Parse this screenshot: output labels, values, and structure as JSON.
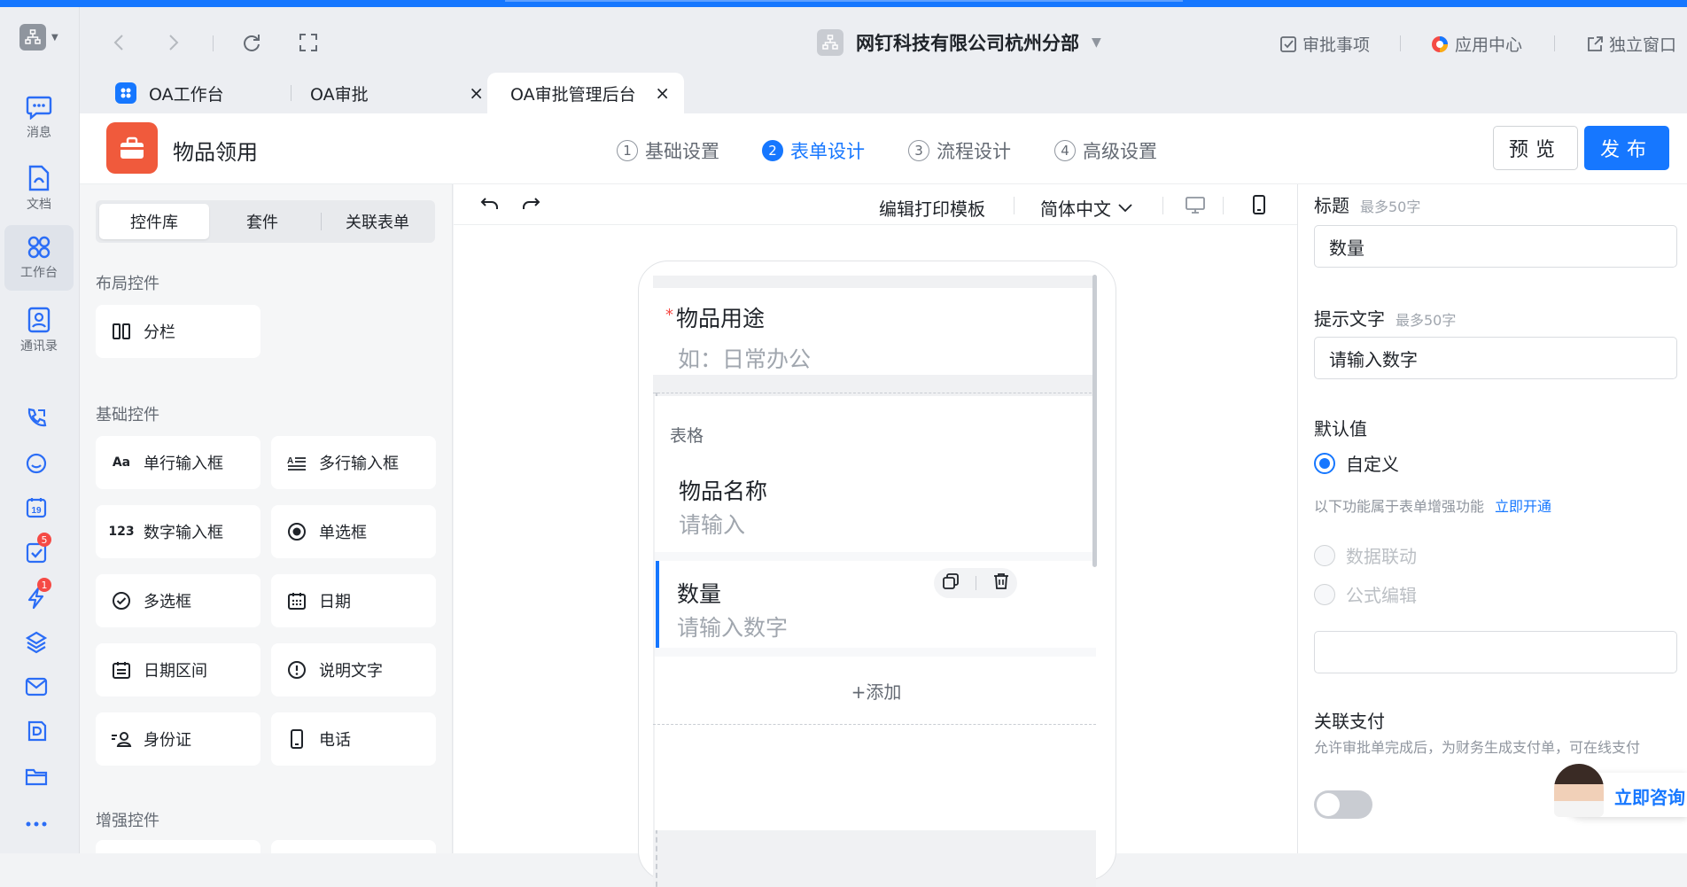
{
  "window": {
    "org_name": "网钉科技有限公司杭州分部"
  },
  "top_right": {
    "approval_items": "审批事项",
    "app_center": "应用中心",
    "standalone_window": "独立窗口"
  },
  "rail": {
    "items": [
      {
        "label": "消息"
      },
      {
        "label": "文档"
      },
      {
        "label": "工作台"
      },
      {
        "label": "通讯录"
      }
    ],
    "badges": {
      "todo": "5",
      "flash": "1"
    }
  },
  "tabs": [
    {
      "label": "OA工作台"
    },
    {
      "label": "OA审批"
    },
    {
      "label": "OA审批管理后台"
    }
  ],
  "header": {
    "app_title": "物品领用",
    "steps": [
      {
        "num": "1",
        "label": "基础设置"
      },
      {
        "num": "2",
        "label": "表单设计"
      },
      {
        "num": "3",
        "label": "流程设计"
      },
      {
        "num": "4",
        "label": "高级设置"
      }
    ],
    "preview_label": "预览",
    "publish_label": "发布"
  },
  "left_panel": {
    "segments": [
      "控件库",
      "套件",
      "关联表单"
    ],
    "groups": {
      "layout": "布局控件",
      "basic": "基础控件",
      "enhanced": "增强控件"
    },
    "layout_controls": [
      {
        "label": "分栏"
      }
    ],
    "basic_controls": [
      {
        "label": "单行输入框",
        "icon_text": "Aa"
      },
      {
        "label": "多行输入框"
      },
      {
        "label": "数字输入框",
        "icon_text": "123"
      },
      {
        "label": "单选框"
      },
      {
        "label": "多选框"
      },
      {
        "label": "日期"
      },
      {
        "label": "日期区间"
      },
      {
        "label": "说明文字"
      },
      {
        "label": "身份证"
      },
      {
        "label": "电话"
      }
    ]
  },
  "canvas": {
    "edit_print_template": "编辑打印模板",
    "language": "简体中文",
    "form": {
      "purpose_label": "物品用途",
      "purpose_placeholder": "如：日常办公",
      "table_label": "表格",
      "item_name_label": "物品名称",
      "item_name_placeholder": "请输入",
      "quantity_label": "数量",
      "quantity_placeholder": "请输入数字",
      "add_label": "+添加"
    }
  },
  "right_panel": {
    "title_label": "标题",
    "title_hint": "最多50字",
    "title_value": "数量",
    "prompt_label": "提示文字",
    "prompt_hint": "最多50字",
    "prompt_value": "请输入数字",
    "default_label": "默认值",
    "custom_option": "自定义",
    "enhanced_notice": "以下功能属于表单增强功能",
    "enable_link": "立即开通",
    "data_linkage": "数据联动",
    "formula_edit": "公式编辑",
    "payment_label": "关联支付",
    "payment_desc": "允许审批单完成后，为财务生成支付单，可在线支付",
    "consult": "立即咨询"
  },
  "colors": {
    "accent": "#1677ff",
    "app_icon": "#f05a3c",
    "badge": "#f54a45"
  }
}
